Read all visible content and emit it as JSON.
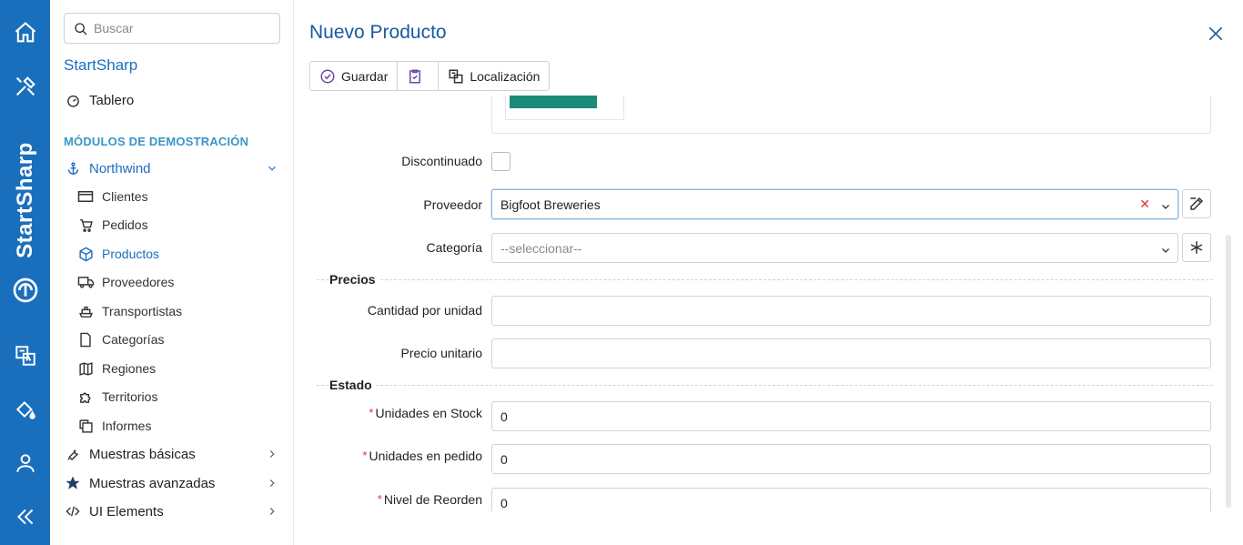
{
  "rail": {
    "brand": "StartSharp"
  },
  "sidebar": {
    "search_placeholder": "Buscar",
    "app_title": "StartSharp",
    "dashboard": "Tablero",
    "section": "MÓDULOS DE DEMOSTRACIÓN",
    "northwind": "Northwind",
    "items": [
      {
        "label": "Clientes"
      },
      {
        "label": "Pedidos"
      },
      {
        "label": "Productos"
      },
      {
        "label": "Proveedores"
      },
      {
        "label": "Transportistas"
      },
      {
        "label": "Categorías"
      },
      {
        "label": "Regiones"
      },
      {
        "label": "Territorios"
      },
      {
        "label": "Informes"
      }
    ],
    "basic": "Muestras básicas",
    "advanced": "Muestras avanzadas",
    "ui": "UI Elements"
  },
  "dialog": {
    "title": "Nuevo Producto",
    "toolbar": {
      "save": "Guardar",
      "localization": "Localización"
    },
    "fields": {
      "discontinued": "Discontinuado",
      "supplier_label": "Proveedor",
      "supplier_value": "Bigfoot Breweries",
      "category_label": "Categoría",
      "category_placeholder": "--seleccionar--",
      "prices": "Precios",
      "qty_label": "Cantidad por unidad",
      "price_label": "Precio unitario",
      "status": "Estado",
      "stock_label": "Unidades en Stock",
      "stock_value": "0",
      "order_label": "Unidades en pedido",
      "order_value": "0",
      "reorder_label": "Nivel de Reorden",
      "reorder_value": "0",
      "required_mark": "*"
    }
  },
  "colors": {
    "rail": "#1a6fbd",
    "accent": "#1a6fbd",
    "section": "#3a95c8"
  }
}
